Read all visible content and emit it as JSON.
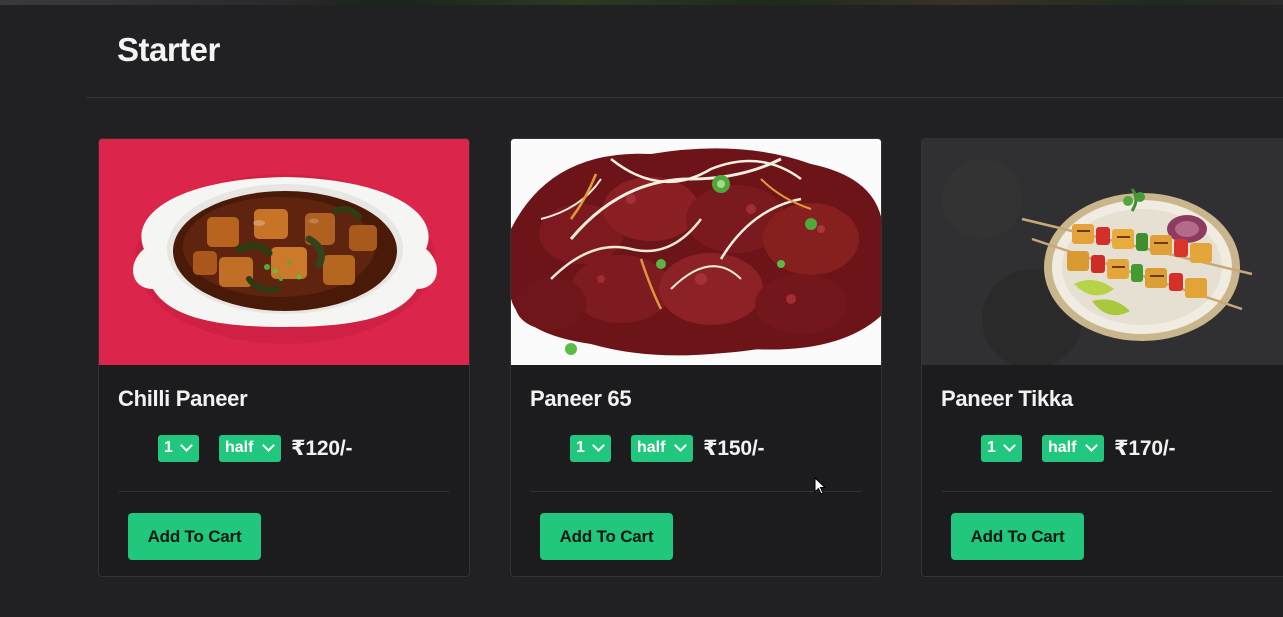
{
  "section": {
    "title": "Starter"
  },
  "items": [
    {
      "name": "Chilli Paneer",
      "quantity": "1",
      "size": "half",
      "price": "₹120/-",
      "add_label": "Add To Cart",
      "image_icon": "chilli-paneer-photo"
    },
    {
      "name": "Paneer 65",
      "quantity": "1",
      "size": "half",
      "price": "₹150/-",
      "add_label": "Add To Cart",
      "image_icon": "paneer-65-photo"
    },
    {
      "name": "Paneer Tikka",
      "quantity": "1",
      "size": "half",
      "price": "₹170/-",
      "add_label": "Add To Cart",
      "image_icon": "paneer-tikka-photo"
    }
  ],
  "colors": {
    "background": "#212123",
    "card": "#1c1c1e",
    "accent": "#20c77d",
    "text": "#f2f2f2"
  }
}
